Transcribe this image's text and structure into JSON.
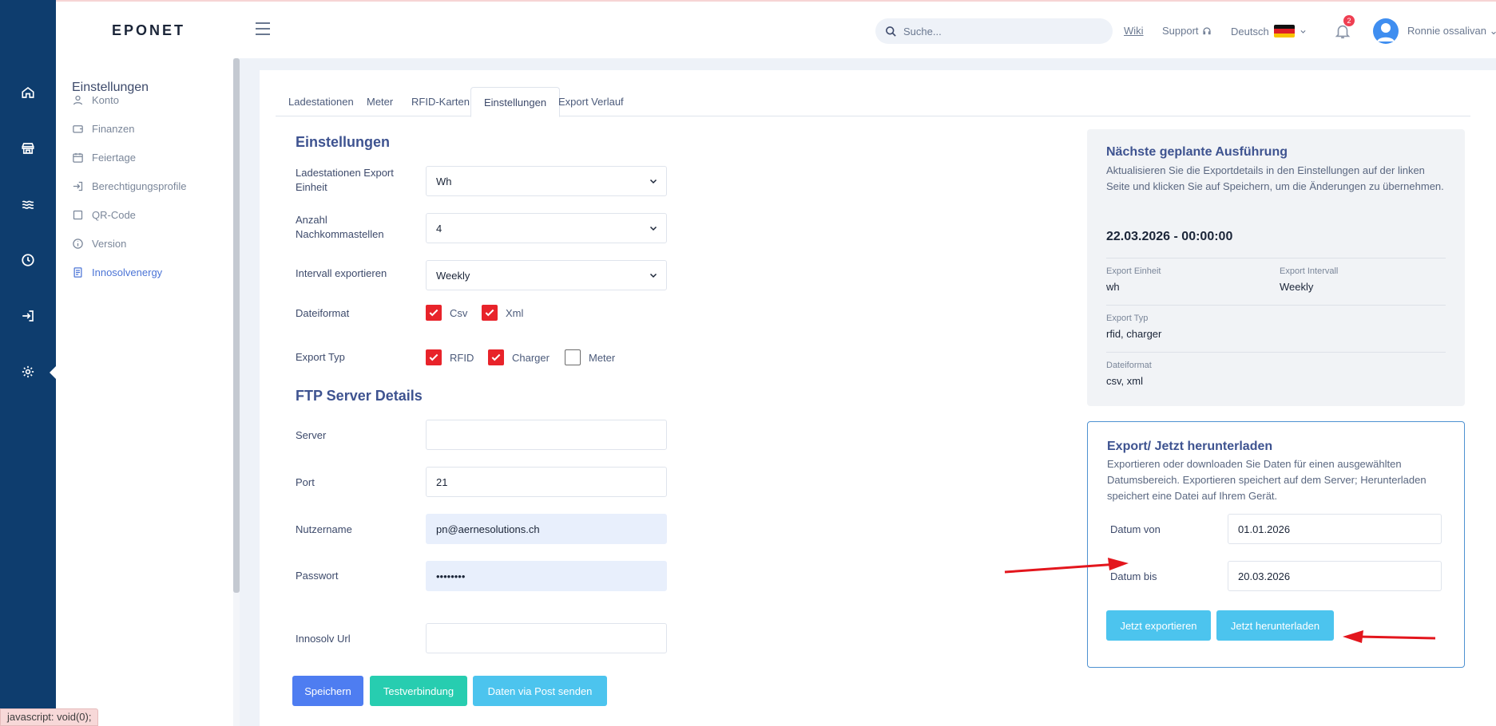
{
  "header": {
    "logo": "EPONET",
    "search_placeholder": "Suche...",
    "wiki": "Wiki",
    "support": "Support",
    "language": "Deutsch",
    "notification_count": "2",
    "user_name": "Ronnie ossalivan"
  },
  "sidebar": {
    "title": "Einstellungen",
    "items": [
      {
        "label": "Konto",
        "icon": "user-icon"
      },
      {
        "label": "Finanzen",
        "icon": "wallet-icon"
      },
      {
        "label": "Feiertage",
        "icon": "calendar-icon"
      },
      {
        "label": "Berechtigungsprofile",
        "icon": "login-icon"
      },
      {
        "label": "QR-Code",
        "icon": "square-icon"
      },
      {
        "label": "Version",
        "icon": "info-icon"
      },
      {
        "label": "Innosolvenergy",
        "icon": "document-icon",
        "active": true
      }
    ]
  },
  "tabs": [
    "Ladestationen",
    "Meter",
    "RFID-Karten",
    "Einstellungen",
    "Export Verlauf"
  ],
  "active_tab": "Einstellungen",
  "settings": {
    "title": "Einstellungen",
    "export_unit_label": "Ladestationen Export Einheit",
    "export_unit_value": "Wh",
    "decimals_label": "Anzahl Nachkommastellen",
    "decimals_value": "4",
    "interval_label": "Intervall exportieren",
    "interval_value": "Weekly",
    "file_format_label": "Dateiformat",
    "file_formats": [
      {
        "label": "Csv",
        "checked": true
      },
      {
        "label": "Xml",
        "checked": true
      }
    ],
    "export_type_label": "Export Typ",
    "export_types": [
      {
        "label": "RFID",
        "checked": true
      },
      {
        "label": "Charger",
        "checked": true
      },
      {
        "label": "Meter",
        "checked": false
      }
    ]
  },
  "ftp": {
    "title": "FTP Server Details",
    "server_label": "Server",
    "server_value": "",
    "port_label": "Port",
    "port_value": "21",
    "username_label": "Nutzername",
    "username_value": "pn@aernesolutions.ch",
    "password_label": "Passwort",
    "password_value": "••••••••",
    "url_label": "Innosolv Url",
    "url_value": ""
  },
  "buttons": {
    "save": "Speichern",
    "test": "Testverbindung",
    "post": "Daten via Post senden"
  },
  "next_run": {
    "title": "Nächste geplante Ausführung",
    "description": "Aktualisieren Sie die Exportdetails in den Einstellungen auf der linken Seite und klicken Sie auf Speichern, um die Änderungen zu übernehmen.",
    "datetime": "22.03.2026 - 00:00:00",
    "unit_label": "Export Einheit",
    "unit_value": "wh",
    "interval_label": "Export Intervall",
    "interval_value": "Weekly",
    "type_label": "Export Typ",
    "type_value": "rfid, charger",
    "format_label": "Dateiformat",
    "format_value": "csv, xml"
  },
  "export": {
    "title": "Export/ Jetzt herunterladen",
    "description": "Exportieren oder downloaden Sie Daten für einen ausgewählten Datumsbereich. Exportieren speichert auf dem Server; Herunterladen speichert eine Datei auf Ihrem Gerät.",
    "from_label": "Datum von",
    "from_value": "01.01.2026",
    "to_label": "Datum bis",
    "to_value": "20.03.2026",
    "export_button": "Jetzt exportieren",
    "download_button": "Jetzt herunterladen"
  },
  "status_bar": "javascript: void(0);",
  "colors": {
    "rail": "#0e3d6e",
    "accent": "#4e7df1",
    "checkbox": "#e8232a",
    "annotation_arrow": "#e3161d"
  }
}
